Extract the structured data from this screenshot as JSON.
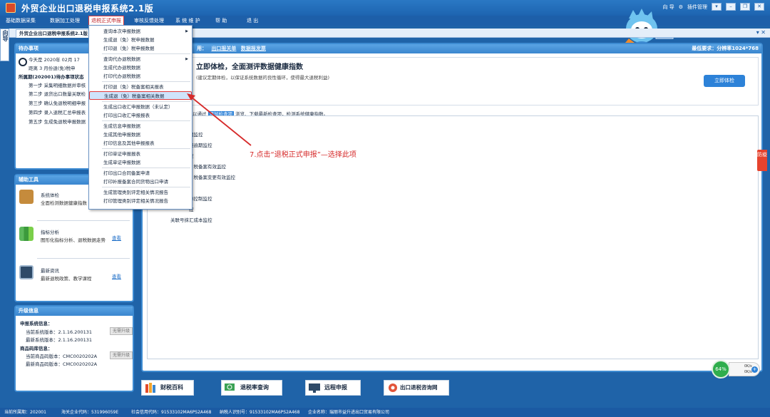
{
  "app": {
    "title": "外贸企业出口退税申报系统2.1版"
  },
  "topright": {
    "guide": "向 导",
    "plugin": "插件管理"
  },
  "menubar": [
    "基础数据采集",
    "数据加工处理",
    "退税正式申报",
    "审核反馈处理",
    "系 统 维 护",
    "帮  助",
    "退  出"
  ],
  "tab": {
    "label": "外贸企业出口退税申报系统2.1版"
  },
  "guide_label": "向导",
  "todo": {
    "header": "待办事项",
    "date": "今天是 2020年 02月 17",
    "deadline": "距离 3 月份退(免)税申",
    "period": "所属期(202001)待办事项状态",
    "steps": [
      "第一步 采集明细数据并审核",
      "第二步 退货出口数量关联检",
      "第三步 确认免退税明细申报",
      "第四步 录入退税汇总申报表",
      "第五步 生成免退税申报数据"
    ]
  },
  "tools": {
    "header": "辅助工具",
    "items": [
      {
        "title": "系统体检",
        "desc": "全面检测数据健康指数",
        "link": ""
      },
      {
        "title": "指标分析",
        "desc": "图形化指标分析、退税数据走势",
        "link": "查看"
      },
      {
        "title": "最新资讯",
        "desc": "最新退税政策、教学课程",
        "link": "查看"
      }
    ]
  },
  "upgrade": {
    "header": "升级信息",
    "sys_title": "申报系统信息：",
    "sys_current": "当前系统版本：2.1.16.200131",
    "sys_latest": "最新系统版本：2.1.16.200131",
    "code_title": "商品码库信息：",
    "code_current": "当前商品码版本：CMC0020202A",
    "code_latest": "最新商品码版本：CMC0020202A",
    "btn": "无需升级"
  },
  "main": {
    "header_prefix": "用：",
    "link1": "出口报关单",
    "link2": "数据报发票",
    "resolution": "最低要求：分辨率1024*768",
    "check_title": "立即体检，全面测评数据健康指数",
    "check_sub": "(建议定期体检，以保证系统数据的良性循环，使得最大退税利益)",
    "check_btn": "立即体检",
    "hint_pre": "以通过",
    "hint_blue": "添加检查项",
    "hint_post": "浏览、下载最新检查项，检测系统健康指数。",
    "list": [
      "期监控",
      "报逾期监控",
      "控",
      "）税备案有效监控",
      "）税备案变更有效监控",
      "",
      "单控制监控",
      "控",
      "关联号抹汇成本监控"
    ]
  },
  "menu": {
    "items": [
      "查询本次申报数据",
      "生成退（免）税申报数据",
      "打印退（免）税申报数据",
      "查询代办退税数据",
      "生成代办退税数据",
      "打印代办退税数据",
      "打印退（免）税备案相关报表",
      "生成退（免）税备案相关数据",
      "生成出口收汇申报数据（未认定）",
      "打印出口收汇申报报表",
      "生成信息申报数据",
      "生成其他申报数据",
      "打印信息及其他申报报表",
      "打印单证申报报表",
      "生成单证申报数据",
      "打印出口合同备案申请",
      "打印补报备案合同货物出口申请",
      "生成管理类别评定相关情况报告",
      "打印管理类别评定相关情况报告"
    ],
    "selected_index": 7
  },
  "annotation": "7.点击“退税正式申报”—选择此项",
  "sidetab": "防疫",
  "gauge": {
    "percent": "64%",
    "up": "0K/s",
    "down": "0K/s"
  },
  "bottom": [
    "财税百科",
    "退税率查询",
    "远程申报",
    "出口退税咨询网"
  ],
  "status": {
    "period": "当前所属期：202001",
    "customs": "海关企业代码：531996059E",
    "credit": "社会信用代码：91533102MA6PS2A468",
    "taxid": "纳税人识别号：91533102MA6PS2A468",
    "company": "企业名称：瑞丽市益升进出口贸易有限公司"
  },
  "colors": {
    "accent": "#2d82d8",
    "title": "#1d64b0",
    "highlight": "#e23b3b"
  }
}
